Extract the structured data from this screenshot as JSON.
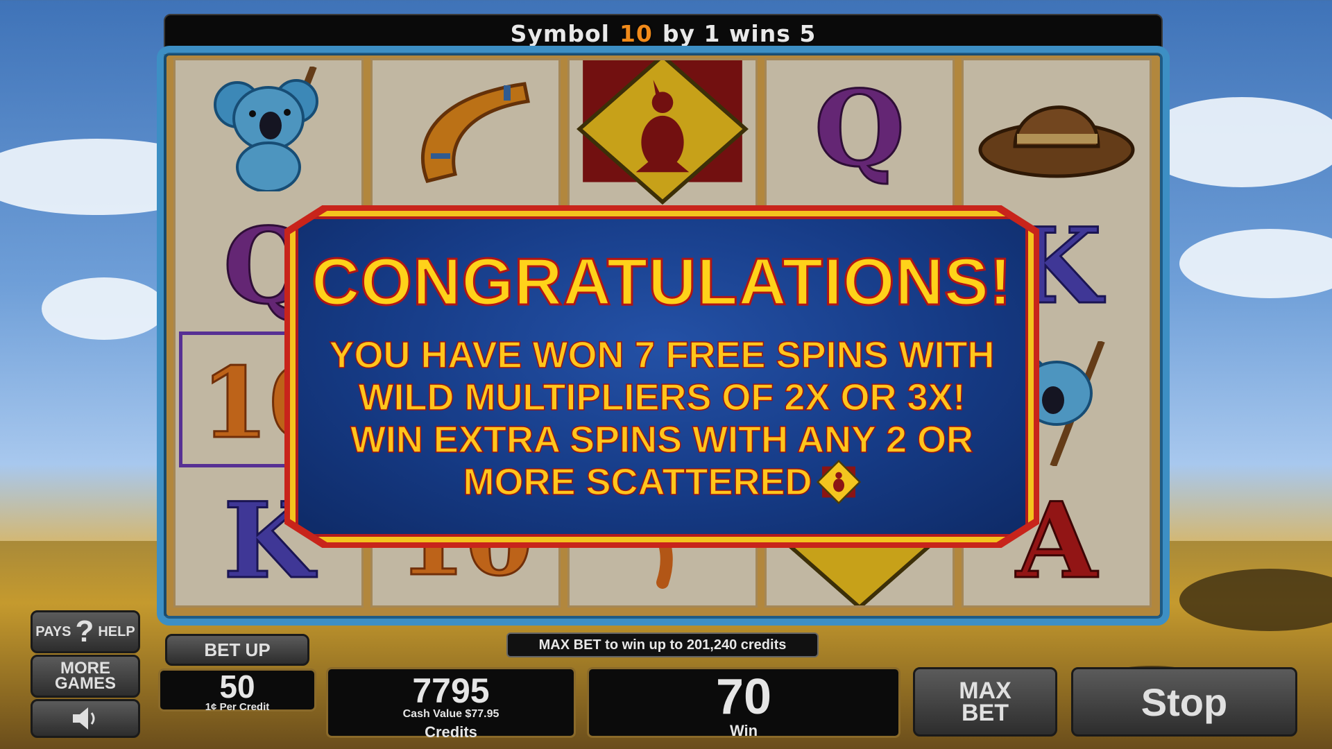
{
  "banner": {
    "prefix": "Symbol",
    "symbol": "10",
    "suffix": "by 1 wins 5"
  },
  "dialog": {
    "title": "CONGRATULATIONS!",
    "lines": [
      "YOU HAVE WON 7 FREE SPINS WITH",
      "WILD MULTIPLIERS OF 2X OR 3X!",
      "WIN EXTRA SPINS WITH ANY 2 OR",
      "MORE SCATTERED"
    ]
  },
  "reels": {
    "letters": {
      "q": "Q",
      "c": "Q",
      "k": "K",
      "a": "A",
      "ten": "10"
    }
  },
  "controls": {
    "pays": "PAYS",
    "help": "HELP",
    "more_games": "MORE GAMES",
    "bet_up": "BET UP",
    "max_bet_info": "MAX BET to win up to 201,240 credits",
    "max_bet": "MAX BET",
    "stop": "Stop"
  },
  "bet": {
    "value": "50",
    "denomination": "1¢ Per Credit"
  },
  "credits": {
    "value": "7795",
    "cash_value": "Cash Value $77.95",
    "label": "Credits"
  },
  "win": {
    "value": "70",
    "label": "Win"
  },
  "colors": {
    "dialog_text": "#ffc61c",
    "dialog_border": "#f4c31e",
    "frame": "#3d8fc4"
  }
}
